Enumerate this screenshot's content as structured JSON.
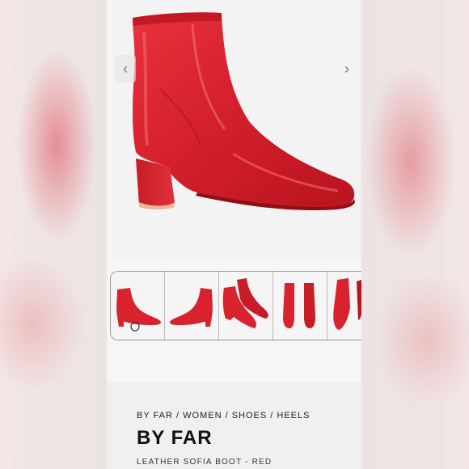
{
  "gallery": {
    "prev_icon": "chevron-left-icon",
    "next_icon": "chevron-right-icon",
    "thumbnails": [
      {
        "view": "side-view"
      },
      {
        "view": "inner-side-view"
      },
      {
        "view": "pair-angled-view"
      },
      {
        "view": "front-view"
      },
      {
        "view": "sole-view"
      }
    ],
    "boot_color": "#d8232f"
  },
  "breadcrumb": {
    "brand": "BY FAR",
    "women": "WOMEN",
    "shoes": "SHOES",
    "heels": "HEELS",
    "separator": "/"
  },
  "product": {
    "brand": "BY FAR",
    "name": "LEATHER SOFIA BOOT - RED"
  }
}
